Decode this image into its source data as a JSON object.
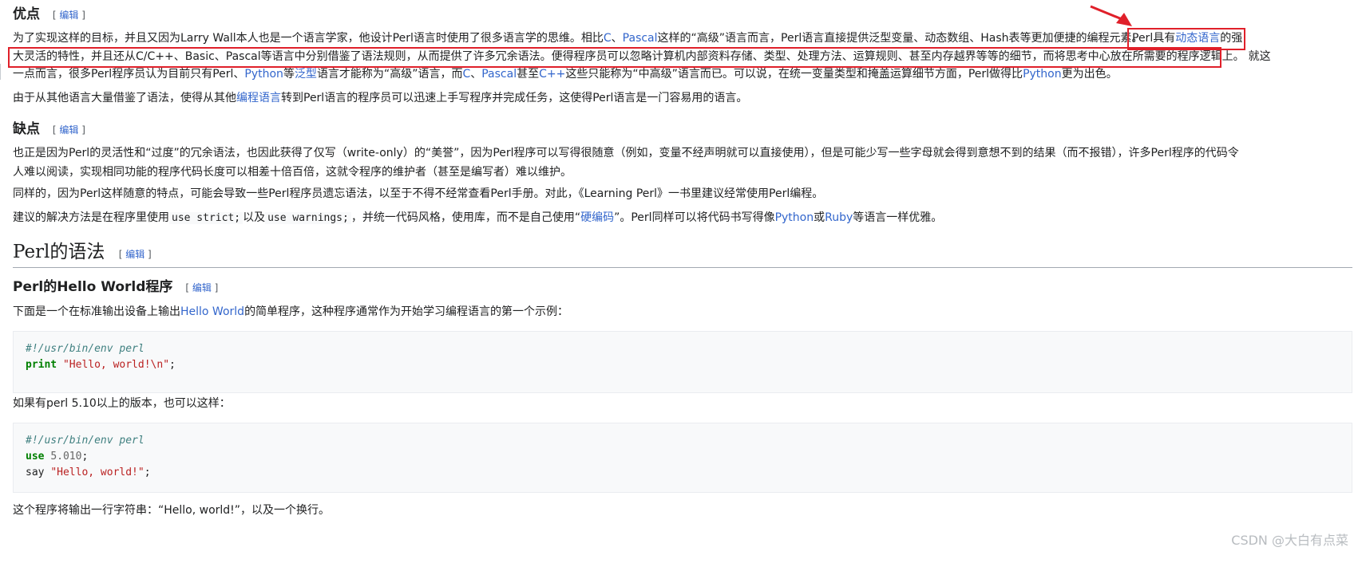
{
  "edit_label": "编辑",
  "sec_pros": {
    "heading": "优点",
    "p1": {
      "t1": "为了实现这样的目标，并且又因为Larry Wall本人也是一个语言学家，他设计Perl语言时使用了很多语言学的思维。相比",
      "l_c": "C",
      "t2": "、",
      "l_pascal": "Pascal",
      "t3": "这样的“高级”语言而言，Perl语言直接提供泛型变量、动态数组、Hash表等更加便捷的编程元素。",
      "t4": "Perl具有",
      "l_dyn": "动态语言",
      "t5": "的强",
      "t6": "大灵活的特性，并且还从C/C++、Basic、Pascal等语言中分别借鉴了语法规则，从而提供了许多冗余语法。便得程序员可以忽略计算机内部资料存储、类型、处理方法、运算规则、甚至内存越界等等的细节，而将思考中心放在所需要的程序逻辑上。",
      "t7": "就这",
      "t8": "一点而言，很多Perl程序员认为目前只有Perl、",
      "l_python": "Python",
      "t9": "等",
      "l_generic": "泛型",
      "t10": "语言才能称为“高级”语言，而",
      "l_c2": "C",
      "t11": "、",
      "l_pascal2": "Pascal",
      "t12": "甚至",
      "l_cpp": "C++",
      "t13": "这些只能称为“中高级”语言而已。可以说，在统一变量类型和掩盖运算细节方面，Perl做得比",
      "l_python2": "Python",
      "t14": "更为出色。"
    },
    "p2": {
      "t1": "由于从其他语言大量借鉴了语法，使得从其他",
      "l_prog": "编程语言",
      "t2": "转到Perl语言的程序员可以迅速上手写程序并完成任务，这使得Perl语言是一门容易用的语言。"
    }
  },
  "sec_cons": {
    "heading": "缺点",
    "p1": "也正是因为Perl的灵活性和“过度”的冗余语法，也因此获得了仅写（write-only）的“美誉”，因为Perl程序可以写得很随意（例如，变量不经声明就可以直接使用），但是可能少写一些字母就会得到意想不到的结果（而不报错），许多Perl程序的代码令人难以阅读，实现相同功能的程序代码长度可以相差十倍百倍，这就令程序的维护者（甚至是编写者）难以维护。",
    "p2": "同样的，因为Perl这样随意的特点，可能会导致一些Perl程序员遗忘语法，以至于不得不经常查看Perl手册。对此，《Learning Perl》一书里建议经常使用Perl编程。",
    "p3": {
      "t1": "建议的解决方法是在程序里使用",
      "code1": "use strict;",
      "t2": "以及",
      "code2": "use warnings;",
      "t3": "，并统一代码风格，使用库，而不是自己使用“",
      "l_hard": "硬编码",
      "t4": "”。Perl同样可以将代码书写得像",
      "l_python": "Python",
      "t5": "或",
      "l_ruby": "Ruby",
      "t6": "等语言一样优雅。"
    }
  },
  "sec_syntax": {
    "heading": "Perl的语法"
  },
  "sec_hello": {
    "heading": "Perl的Hello World程序",
    "intro": {
      "t1": "下面是一个在标准输出设备上输出",
      "l_hw": "Hello World",
      "t2": "的简单程序，这种程序通常作为开始学习编程语言的第一个示例："
    },
    "code1": {
      "shebang": "#!/usr/bin/env perl",
      "kw": "print",
      "str": "\"Hello, world!\\n\"",
      "end": ";"
    },
    "mid": "如果有perl 5.10以上的版本，也可以这样：",
    "code2": {
      "shebang": "#!/usr/bin/env perl",
      "kw_use": "use",
      "ver": "5.010",
      "end1": ";",
      "say": "say",
      "str": "\"Hello, world!\"",
      "end2": ";"
    },
    "outro": "这个程序将输出一行字符串：“Hello, world!”，以及一个换行。"
  },
  "watermark": "CSDN @大白有点菜",
  "colors": {
    "link": "#3366cc",
    "highlight_box": "#e0202a",
    "arrow": "#e0202a"
  }
}
